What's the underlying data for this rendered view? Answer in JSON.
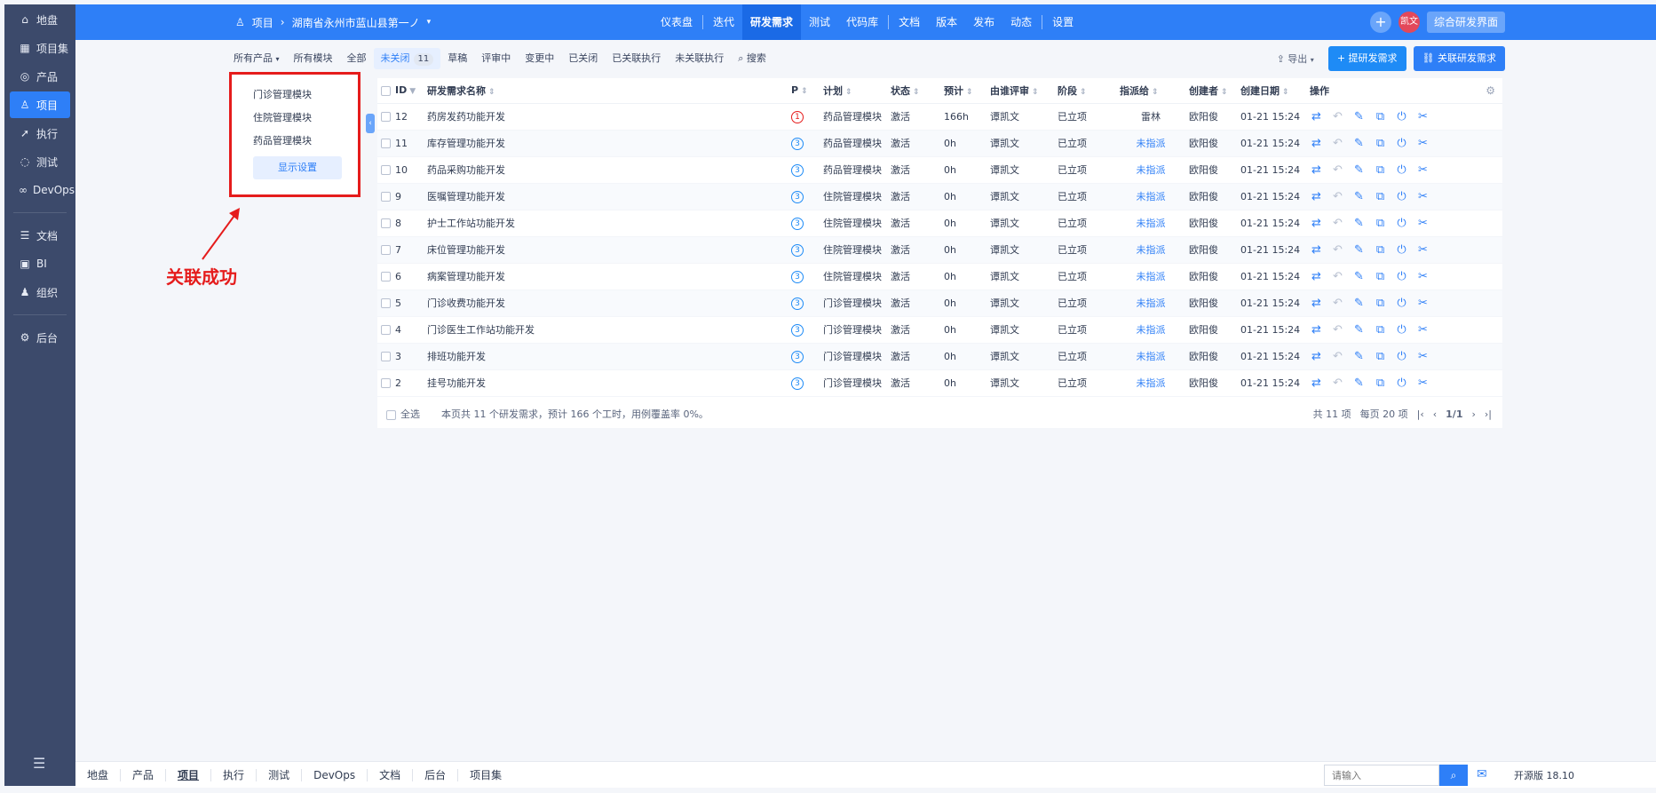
{
  "left_nav": {
    "items": [
      {
        "icon": "home-icon",
        "glyph": "⌂",
        "label": "地盘"
      },
      {
        "icon": "grid-icon",
        "glyph": "▦",
        "label": "项目集"
      },
      {
        "icon": "bulb-icon",
        "glyph": "◎",
        "label": "产品"
      },
      {
        "icon": "project-icon",
        "glyph": "♙",
        "label": "项目",
        "active": true
      },
      {
        "icon": "run-icon",
        "glyph": "➚",
        "label": "执行"
      },
      {
        "icon": "test-icon",
        "glyph": "◌",
        "label": "测试"
      },
      {
        "icon": "devops-icon",
        "glyph": "∞",
        "label": "DevOps"
      },
      {
        "icon": "doc-icon",
        "glyph": "☰",
        "label": "文档"
      },
      {
        "icon": "bi-icon",
        "glyph": "▣",
        "label": "BI"
      },
      {
        "icon": "org-icon",
        "glyph": "♟",
        "label": "组织"
      },
      {
        "icon": "admin-icon",
        "glyph": "⚙",
        "label": "后台"
      }
    ]
  },
  "header": {
    "breadcrumb_root": "项目",
    "breadcrumb_project": "湖南省永州市蓝山县第一ノ",
    "nav": [
      "仪表盘",
      "迭代",
      "研发需求",
      "测试",
      "代码库",
      "文档",
      "版本",
      "发布",
      "动态",
      "设置"
    ],
    "nav_active": "研发需求",
    "avatar": "凯文",
    "workspace_btn": "综合研发界面",
    "accent": "#2e7ff7"
  },
  "toolbar": {
    "product_filter": "所有产品",
    "module_filter": "所有模块",
    "tabs": [
      "全部",
      "未关闭",
      "草稿",
      "评审中",
      "变更中",
      "已关闭",
      "已关联执行",
      "未关联执行"
    ],
    "active_tab": "未关闭",
    "active_count": "11",
    "search": "搜索",
    "export": "导出",
    "btn_create": "提研发需求",
    "btn_link": "关联研发需求"
  },
  "module_panel": {
    "items": [
      "门诊管理模块",
      "住院管理模块",
      "药品管理模块"
    ],
    "settings": "显示设置",
    "highlight_color": "#e51c1c"
  },
  "annotation": "关联成功",
  "table": {
    "headers": [
      "ID",
      "研发需求名称",
      "P",
      "计划",
      "状态",
      "预计",
      "由谁评审",
      "阶段",
      "指派给",
      "创建者",
      "创建日期",
      "操作"
    ],
    "rows": [
      {
        "id": "12",
        "name": "药房发药功能开发",
        "p": "1",
        "plan": "药品管理模块",
        "status": "激活",
        "est": "166h",
        "reviewer": "谭凯文",
        "stage": "已立项",
        "assign": "雷林",
        "creator": "欧阳俊",
        "date": "01-21 15:24"
      },
      {
        "id": "11",
        "name": "库存管理功能开发",
        "p": "3",
        "plan": "药品管理模块",
        "status": "激活",
        "est": "0h",
        "reviewer": "谭凯文",
        "stage": "已立项",
        "assign": "未指派",
        "creator": "欧阳俊",
        "date": "01-21 15:24"
      },
      {
        "id": "10",
        "name": "药品采购功能开发",
        "p": "3",
        "plan": "药品管理模块",
        "status": "激活",
        "est": "0h",
        "reviewer": "谭凯文",
        "stage": "已立项",
        "assign": "未指派",
        "creator": "欧阳俊",
        "date": "01-21 15:24"
      },
      {
        "id": "9",
        "name": "医嘱管理功能开发",
        "p": "3",
        "plan": "住院管理模块",
        "status": "激活",
        "est": "0h",
        "reviewer": "谭凯文",
        "stage": "已立项",
        "assign": "未指派",
        "creator": "欧阳俊",
        "date": "01-21 15:24"
      },
      {
        "id": "8",
        "name": "护士工作站功能开发",
        "p": "3",
        "plan": "住院管理模块",
        "status": "激活",
        "est": "0h",
        "reviewer": "谭凯文",
        "stage": "已立项",
        "assign": "未指派",
        "creator": "欧阳俊",
        "date": "01-21 15:24"
      },
      {
        "id": "7",
        "name": "床位管理功能开发",
        "p": "3",
        "plan": "住院管理模块",
        "status": "激活",
        "est": "0h",
        "reviewer": "谭凯文",
        "stage": "已立项",
        "assign": "未指派",
        "creator": "欧阳俊",
        "date": "01-21 15:24"
      },
      {
        "id": "6",
        "name": "病案管理功能开发",
        "p": "3",
        "plan": "住院管理模块",
        "status": "激活",
        "est": "0h",
        "reviewer": "谭凯文",
        "stage": "已立项",
        "assign": "未指派",
        "creator": "欧阳俊",
        "date": "01-21 15:24"
      },
      {
        "id": "5",
        "name": "门诊收费功能开发",
        "p": "3",
        "plan": "门诊管理模块",
        "status": "激活",
        "est": "0h",
        "reviewer": "谭凯文",
        "stage": "已立项",
        "assign": "未指派",
        "creator": "欧阳俊",
        "date": "01-21 15:24"
      },
      {
        "id": "4",
        "name": "门诊医生工作站功能开发",
        "p": "3",
        "plan": "门诊管理模块",
        "status": "激活",
        "est": "0h",
        "reviewer": "谭凯文",
        "stage": "已立项",
        "assign": "未指派",
        "creator": "欧阳俊",
        "date": "01-21 15:24"
      },
      {
        "id": "3",
        "name": "排班功能开发",
        "p": "3",
        "plan": "门诊管理模块",
        "status": "激活",
        "est": "0h",
        "reviewer": "谭凯文",
        "stage": "已立项",
        "assign": "未指派",
        "creator": "欧阳俊",
        "date": "01-21 15:24"
      },
      {
        "id": "2",
        "name": "挂号功能开发",
        "p": "3",
        "plan": "门诊管理模块",
        "status": "激活",
        "est": "0h",
        "reviewer": "谭凯文",
        "stage": "已立项",
        "assign": "未指派",
        "creator": "欧阳俊",
        "date": "01-21 15:24"
      }
    ],
    "select_all": "全选",
    "summary": "本页共 11 个研发需求，预计 166 个工时，用例覆盖率 0%。",
    "total": "共 11 项",
    "per_page": "每页 20 项",
    "page": "1/1"
  },
  "bottom_bar": {
    "items": [
      "地盘",
      "产品",
      "项目",
      "执行",
      "测试",
      "DevOps",
      "文档",
      "后台",
      "项目集"
    ],
    "active": "项目",
    "search_placeholder": "请输入",
    "version": "开源版 18.10"
  }
}
